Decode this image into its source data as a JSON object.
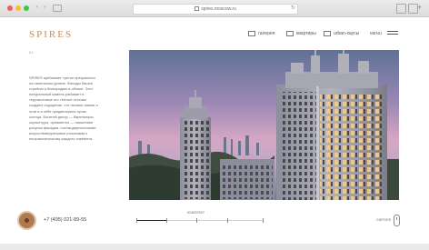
{
  "browser": {
    "url": "spires.moscow.ru"
  },
  "header": {
    "logo": "SPIRES",
    "menu": [
      {
        "label": "галерея",
        "icon": "gallery-icon"
      },
      {
        "label": "квартиры",
        "icon": "apartments-icon"
      },
      {
        "label": "urban-хаусы",
        "icon": "houses-icon"
      }
    ],
    "lang": "MENU"
  },
  "section": {
    "number": "01"
  },
  "description": "SPIRES пребывает третье прекрасного на панельном уровне. Фасады башен стройны и благородны в облике. Этот натуральный камень рабовает в терракотовые его тёплые оттенки создают ощущение, что пылают камни и огни в в себе предвечерних лучах солнца. Богатый декор — барельефы, скульптуры, орнаменты — наполняют рисунок фасадов, постмодернистскими искусствоведческими отсылками к неоклассическому каждого элемента.",
  "footer": {
    "phone": "+7 (495) 021-89-55",
    "progress_label": "КОМПЛЕКТ",
    "progress": 0.24,
    "scroll_label": "СКРОЛЛ"
  },
  "colors": {
    "accent": "#c98d5b",
    "brand_dark": "#2b2b2b"
  }
}
